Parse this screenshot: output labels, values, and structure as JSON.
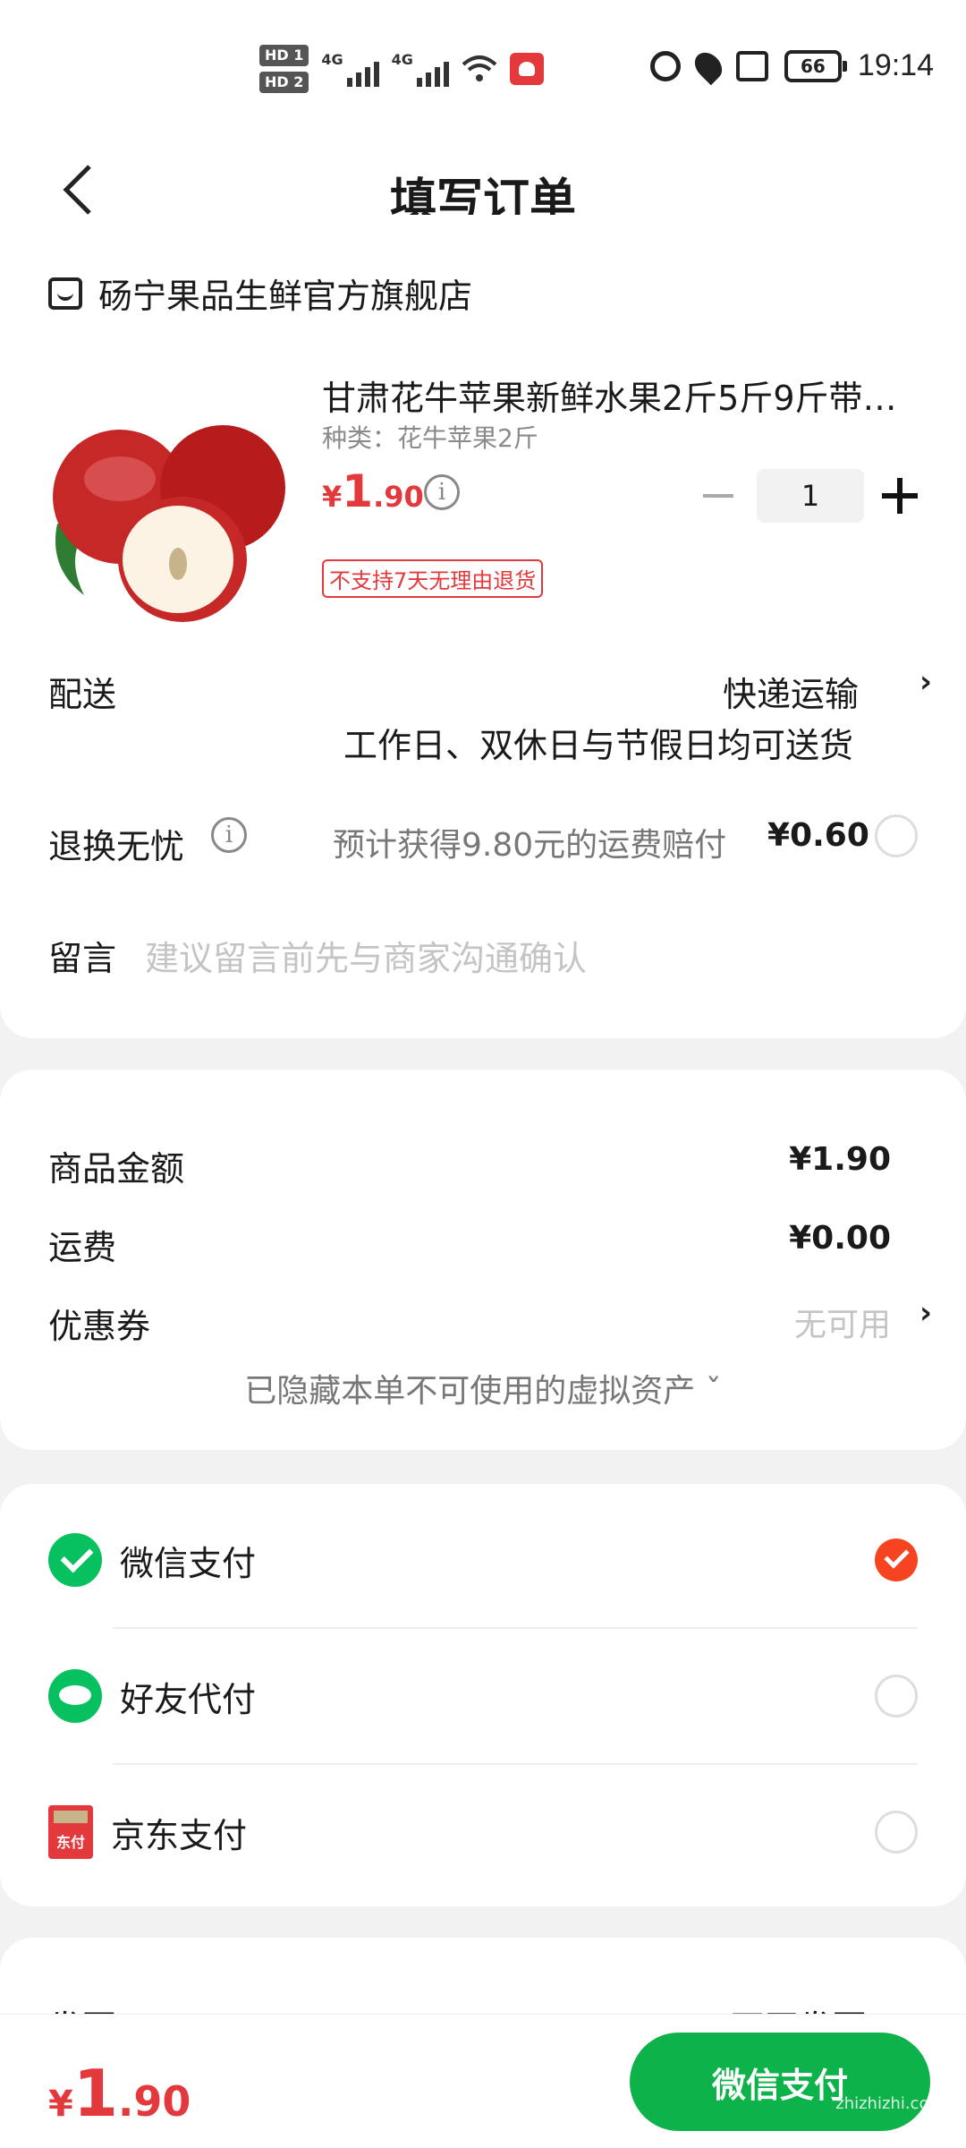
{
  "status_bar": {
    "hd1": "HD 1",
    "hd2": "HD 2",
    "net1": "4G",
    "net2": "4G",
    "battery": "66",
    "time": "19:14"
  },
  "nav": {
    "title": "填写订单"
  },
  "shop": {
    "name": "砀宁果品生鲜官方旗舰店"
  },
  "product": {
    "title": "甘肃花牛苹果新鲜水果2斤5斤9斤带…",
    "spec": "种类：花牛苹果2斤",
    "price_symbol": "¥",
    "price_int": "1",
    "price_dec": ".90",
    "quantity": "1",
    "tag": "不支持7天无理由退货"
  },
  "delivery": {
    "label": "配送",
    "method": "快递运输",
    "note": "工作日、双休日与节假日均可送货"
  },
  "return": {
    "label": "退换无忧",
    "desc": "预计获得9.80元的运费赔付",
    "price": "¥0.60"
  },
  "message": {
    "label": "留言",
    "placeholder": "建议留言前先与商家沟通确认"
  },
  "fees": {
    "goods_label": "商品金额",
    "goods_value": "¥1.90",
    "shipping_label": "运费",
    "shipping_value": "¥0.00",
    "coupon_label": "优惠券",
    "coupon_value": "无可用",
    "hidden_assets": "已隐藏本单不可使用的虚拟资产 ˇ"
  },
  "payment": {
    "options": [
      {
        "label": "微信支付",
        "icon": "wechat-pay-icon",
        "selected": true
      },
      {
        "label": "好友代付",
        "icon": "friend-pay-icon",
        "selected": false
      },
      {
        "label": "京东支付",
        "icon": "jd-pay-icon",
        "selected": false
      }
    ],
    "jd_icon_text": "东付"
  },
  "invoice": {
    "label": "发票",
    "value": "不开发票 ›"
  },
  "bottom": {
    "price_symbol": "¥",
    "price_int": "1",
    "price_dec": ".90",
    "pay_button": "微信支付"
  },
  "watermark": "zhizhizhi.com",
  "colors": {
    "price_red": "#e4393c",
    "wechat_green": "#07c160",
    "pay_button_green": "#0db24a",
    "selected_orange": "#f5441f"
  }
}
